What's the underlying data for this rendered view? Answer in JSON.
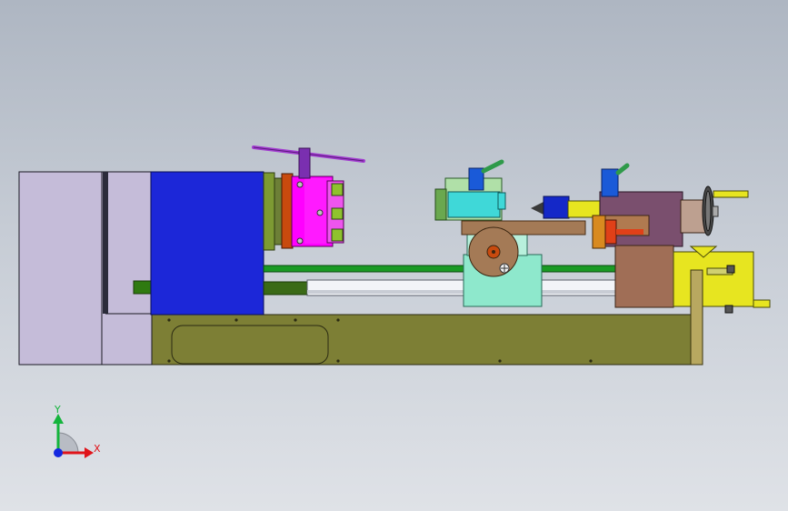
{
  "viewport": {
    "background_top": "#aeb6c2",
    "background_bottom": "#dfe2e7"
  },
  "model": {
    "parts": [
      "headstock-housing",
      "motor-cover",
      "lathe-bed",
      "three-jaw-chuck",
      "chuck-key",
      "carriage-apron",
      "handwheel",
      "tool-post",
      "tailstock",
      "tailstock-handwheel",
      "lead-screw",
      "feed-rod",
      "end-bracket"
    ],
    "colors": {
      "motor_cover": "#c5bcd9",
      "headstock": "#1c27d8",
      "bed": "#7d7f35",
      "chuck_body": "#ff00ff",
      "spindle_flange": "#c84a0e",
      "lead_screw": "#1a9a24",
      "feed_rod": "#f2f4f8",
      "carriage_saddle": "#8ee8cc",
      "cross_slide": "#a47a56",
      "compound": "#3fd8d8",
      "tailstock": "#7a4f6e",
      "end_bracket": "#e7e520",
      "chuck_key": "#a23cd0"
    }
  },
  "triad": {
    "x_label": "X",
    "y_label": "Y",
    "x_color": "#e0141a",
    "y_color": "#14b43c",
    "z_color": "#1428e0"
  }
}
